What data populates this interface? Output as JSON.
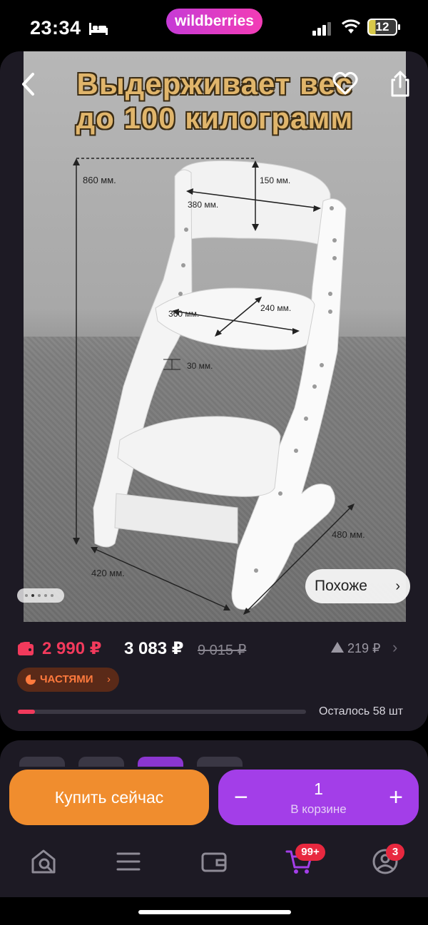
{
  "status_bar": {
    "time": "23:34",
    "battery": "12",
    "brand": "wildberries"
  },
  "product_image": {
    "headline_line1": "Выдерживает вес",
    "headline_line2": "до 100 килограмм",
    "dimensions": {
      "height": "860 мм.",
      "back_height": "150 мм.",
      "back_width": "380 мм.",
      "seat_width": "360 мм.",
      "seat_depth": "240 мм.",
      "gap": "30 мм.",
      "base_width": "420 мм.",
      "base_depth": "480 мм."
    },
    "similar_label": "Похоже",
    "carousel": {
      "count": 5,
      "active_index": 1
    }
  },
  "pricing": {
    "wallet_price": "2 990 ₽",
    "price": "3 083 ₽",
    "old_price": "9 015 ₽",
    "diff": "219 ₽"
  },
  "installments": {
    "label": "ЧАСТЯМИ"
  },
  "stock": {
    "label": "Осталось 58 шт",
    "level": 0.06
  },
  "actions": {
    "buy_now": "Купить сейчас",
    "cart_qty": "1",
    "cart_label": "В корзине"
  },
  "tab_bar": {
    "cart_badge": "99+",
    "profile_badge": "3"
  },
  "colors": {
    "accent": "#a33ee8",
    "price": "#f23a5c",
    "buy": "#f08d2e"
  }
}
